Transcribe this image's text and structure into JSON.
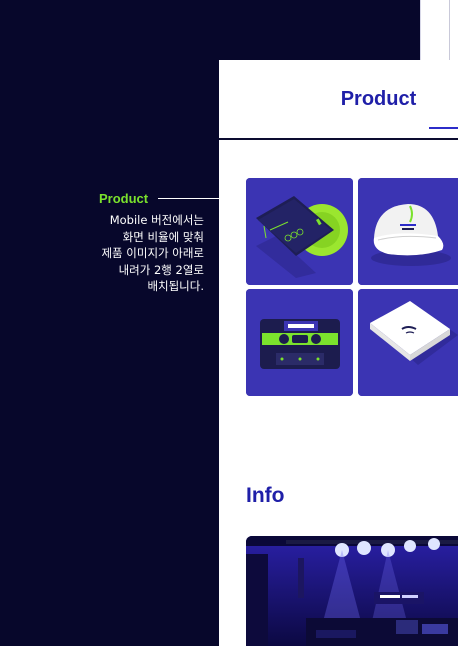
{
  "annotation": {
    "label": "Product",
    "description_lines": [
      "Mobile 버전에서는",
      "화면 비율에 맞춰",
      "제품 이미지가 아래로",
      "내려가 2행 2열로",
      "배치됩니다."
    ]
  },
  "panel": {
    "title": "Product",
    "info_title": "Info"
  },
  "products": [
    {
      "name": "vinyl-record-image",
      "color": "#3a33b0"
    },
    {
      "name": "cap-image",
      "color": "#3a33b0"
    },
    {
      "name": "cassette-image",
      "color": "#3a33b0"
    },
    {
      "name": "tshirt-image",
      "color": "#3a33b0"
    }
  ],
  "colors": {
    "background": "#07072b",
    "accent_green": "#7be22d",
    "brand_blue": "#1f1fa8",
    "tile_blue": "#3a33b0"
  }
}
